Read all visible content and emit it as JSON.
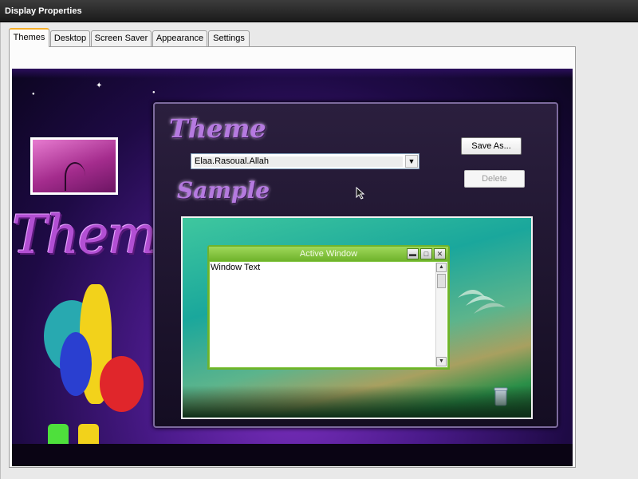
{
  "window": {
    "title": "Display Properties"
  },
  "tabs": [
    {
      "label": "Themes",
      "active": true
    },
    {
      "label": "Desktop",
      "active": false
    },
    {
      "label": "Screen Saver",
      "active": false
    },
    {
      "label": "Appearance",
      "active": false
    },
    {
      "label": "Settings",
      "active": false
    }
  ],
  "artwork": {
    "big_text": "Themes"
  },
  "theme_panel": {
    "theme_heading": "Theme",
    "sample_heading": "Sample",
    "selected_theme": "Elaa.Rasoual.Allah",
    "save_as_label": "Save As...",
    "delete_label": "Delete"
  },
  "preview": {
    "window_title": "Active Window",
    "window_text": "Window Text",
    "minimize_glyph": "▬",
    "maximize_glyph": "□",
    "close_glyph": "✕"
  },
  "colors": {
    "tab_accent": "#f7b02a",
    "active_window_green": "#7ec33d",
    "artwork_purple": "#4a1a8a"
  }
}
